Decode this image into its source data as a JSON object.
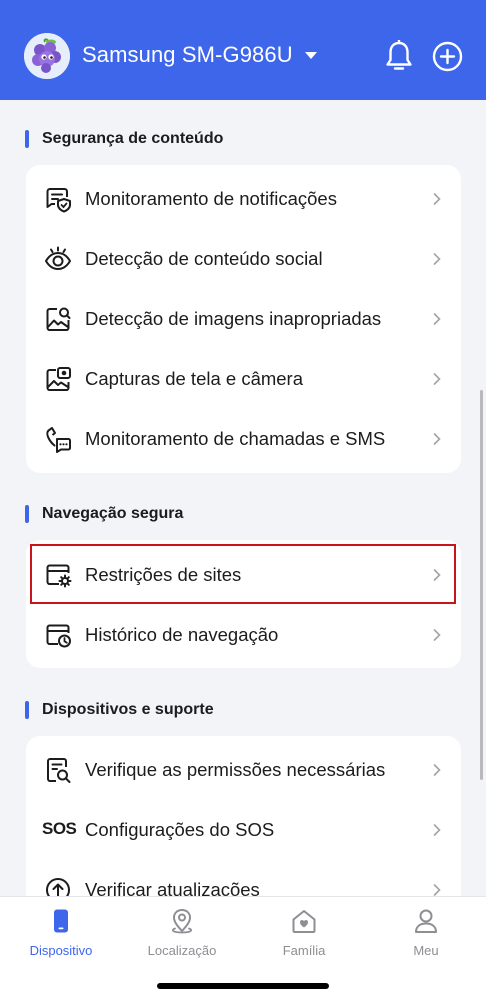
{
  "header": {
    "device_name": "Samsung SM-G986U",
    "avatar_icon": "grape-mascot-avatar",
    "notification_icon": "bell-icon",
    "add_icon": "plus-circle-icon",
    "color": "#3d66eb"
  },
  "sections": [
    {
      "title": "Segurança de conteúdo",
      "items": [
        {
          "label": "Monitoramento de notificações",
          "icon": "notification-shield-icon"
        },
        {
          "label": "Detecção de conteúdo social",
          "icon": "eye-icon"
        },
        {
          "label": "Detecção de imagens inapropriadas",
          "icon": "image-search-icon"
        },
        {
          "label": "Capturas de tela e câmera",
          "icon": "screenshot-camera-icon"
        },
        {
          "label": "Monitoramento de chamadas e SMS",
          "icon": "call-sms-icon"
        }
      ]
    },
    {
      "title": "Navegação segura",
      "items": [
        {
          "label": "Restrições de sites",
          "icon": "browser-settings-icon"
        },
        {
          "label": "Histórico de navegação",
          "icon": "browser-history-icon"
        }
      ]
    },
    {
      "title": "Dispositivos e suporte",
      "items": [
        {
          "label": "Verifique as permissões necessárias",
          "icon": "permission-check-icon"
        },
        {
          "label": "Configurações do SOS",
          "icon": "sos-icon",
          "icon_text": "SOS"
        },
        {
          "label": "Verificar atualizações",
          "icon": "update-arrow-icon"
        }
      ]
    }
  ],
  "tabs": [
    {
      "label": "Dispositivo",
      "icon": "phone-icon",
      "active": true
    },
    {
      "label": "Localização",
      "icon": "location-pin-icon",
      "active": false
    },
    {
      "label": "Família",
      "icon": "family-home-icon",
      "active": false
    },
    {
      "label": "Meu",
      "icon": "person-icon",
      "active": false
    }
  ],
  "colors": {
    "accent": "#3d66eb",
    "highlight_border": "#c4161c"
  }
}
